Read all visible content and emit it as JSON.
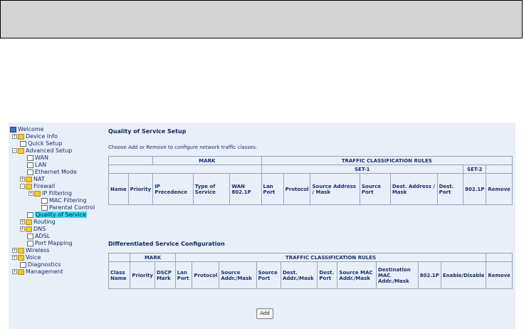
{
  "nav": {
    "items": [
      {
        "label": "Welcome",
        "icon": "computer-icon",
        "expander": ""
      },
      {
        "label": "Device Info",
        "icon": "folder-icon",
        "expander": "+"
      },
      {
        "label": "Quick Setup",
        "icon": "document-icon",
        "expander": ""
      },
      {
        "label": "Advanced Setup",
        "icon": "folder-icon",
        "expander": "-"
      },
      {
        "label": "WAN",
        "icon": "document-icon",
        "expander": ""
      },
      {
        "label": "LAN",
        "icon": "document-icon",
        "expander": ""
      },
      {
        "label": "Ethernet Mode",
        "icon": "document-icon",
        "expander": ""
      },
      {
        "label": "NAT",
        "icon": "folder-icon",
        "expander": "+"
      },
      {
        "label": "Firewall",
        "icon": "folder-icon",
        "expander": "-"
      },
      {
        "label": "IP Filtering",
        "icon": "folder-icon",
        "expander": "+"
      },
      {
        "label": "MAC Filtering",
        "icon": "document-icon",
        "expander": ""
      },
      {
        "label": "Parental Control",
        "icon": "document-icon",
        "expander": ""
      },
      {
        "label": "Quality of Service",
        "icon": "document-icon",
        "expander": ""
      },
      {
        "label": "Routing",
        "icon": "folder-icon",
        "expander": "+"
      },
      {
        "label": "DNS",
        "icon": "folder-icon",
        "expander": "+"
      },
      {
        "label": "ADSL",
        "icon": "document-icon",
        "expander": ""
      },
      {
        "label": "Port Mapping",
        "icon": "document-icon",
        "expander": ""
      },
      {
        "label": "Wireless",
        "icon": "folder-icon",
        "expander": "+"
      },
      {
        "label": "Voice",
        "icon": "folder-icon",
        "expander": "+"
      },
      {
        "label": "Diagnostics",
        "icon": "document-icon",
        "expander": ""
      },
      {
        "label": "Management",
        "icon": "folder-icon",
        "expander": "+"
      }
    ],
    "selected": "Quality of Service"
  },
  "qos": {
    "title": "Quality of Service Setup",
    "description": "Choose Add or Remove to configure network traffic classes.",
    "group_mark": "MARK",
    "group_rules": "TRAFFIC CLASSIFICATION RULES",
    "set1": "SET-1",
    "set2": "SET-2",
    "columns": [
      "Name",
      "Priority",
      "IP Precedence",
      "Type of Service",
      "WAN 802.1P",
      "Lan Port",
      "Protocol",
      "Source Address / Mask",
      "Source Port",
      "Dest. Address / Mask",
      "Dest. Port",
      "802.1P",
      "Remove"
    ]
  },
  "diffserv": {
    "title": "Differentiated Service Configuration",
    "group_mark": "MARK",
    "group_rules": "TRAFFIC CLASSIFICATION RULES",
    "columns": [
      "Class Name",
      "Priority",
      "DSCP Mark",
      "Lan Port",
      "Protocol",
      "Source Addr./Mask",
      "Source Port",
      "Dest. Addr./Mask",
      "Dest. Port",
      "Source MAC Addr./Mask",
      "Destination MAC Addr./Mask",
      "802.1P",
      "Enable/Disable",
      "Remove"
    ],
    "add_label": "Add"
  }
}
